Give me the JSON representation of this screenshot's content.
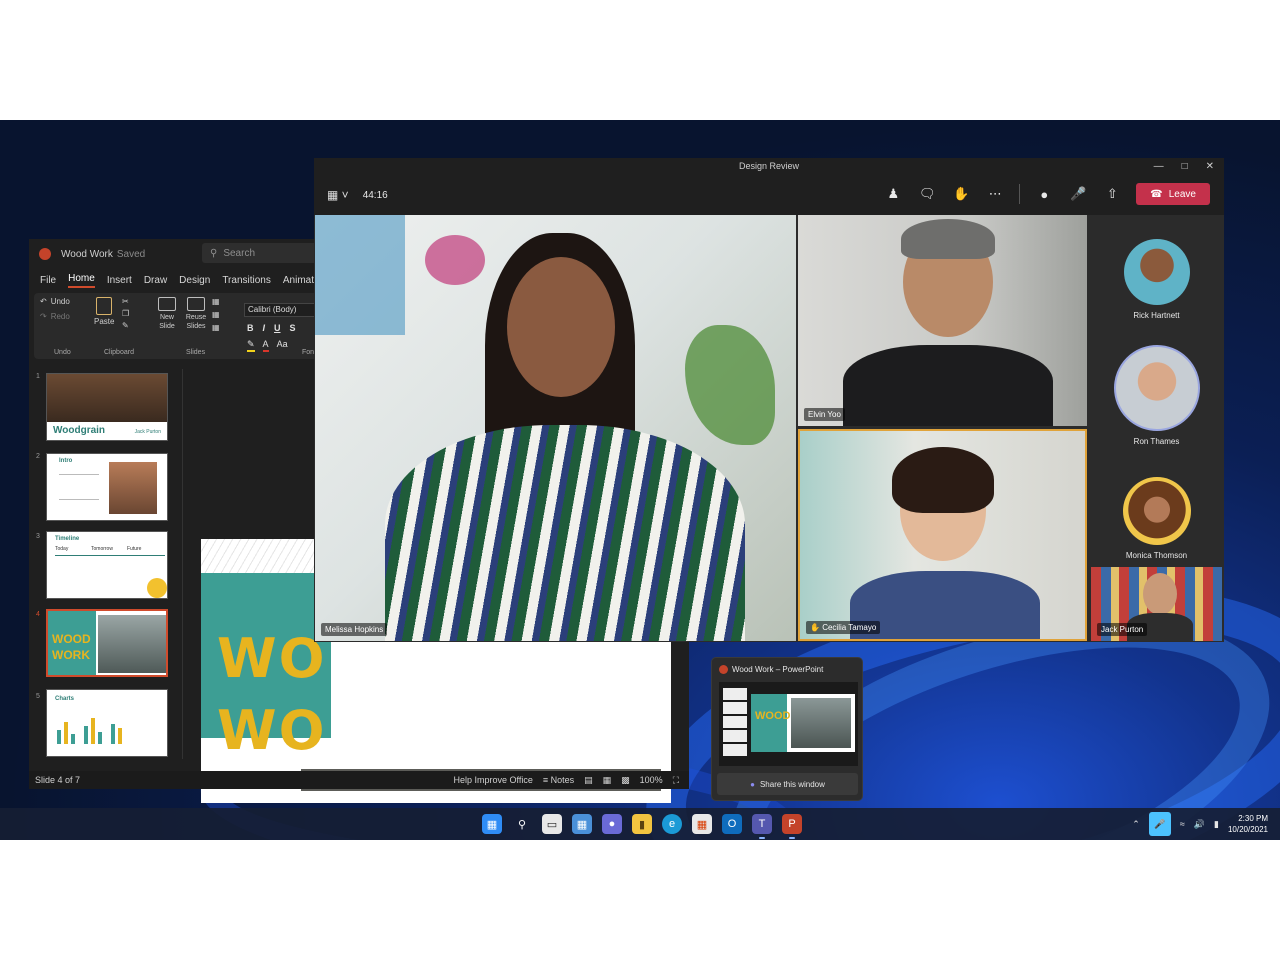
{
  "powerpoint": {
    "doc_name": "Wood Work",
    "saved_status": "Saved",
    "search_placeholder": "Search",
    "tabs": [
      "File",
      "Home",
      "Insert",
      "Draw",
      "Design",
      "Transitions",
      "Animations"
    ],
    "active_tab": "Home",
    "ribbon": {
      "undo": "Undo",
      "redo": "Redo",
      "undo_group": "Undo",
      "paste": "Paste",
      "clipboard_group": "Clipboard",
      "new_slide": "New Slide",
      "reuse_slides": "Reuse Slides",
      "slides_group": "Slides",
      "font_name": "Calibri (Body)",
      "font_group": "Fon"
    },
    "slides": [
      {
        "num": "1",
        "title": "Woodgrain",
        "author": "Jack Purton"
      },
      {
        "num": "2",
        "title": "Intro"
      },
      {
        "num": "3",
        "title": "Timeline",
        "labels": [
          "Today",
          "Tomorrow",
          "Future"
        ]
      },
      {
        "num": "4",
        "title": "WOOD WORK"
      },
      {
        "num": "5",
        "title": "Charts"
      }
    ],
    "canvas_text": [
      "WO",
      "WO"
    ],
    "status": {
      "slide_counter": "Slide 4 of 7",
      "help": "Help Improve Office",
      "notes": "Notes",
      "zoom": "100%"
    }
  },
  "teams": {
    "window_title": "Design Review",
    "call_timer": "44:16",
    "leave_label": "Leave",
    "participants_video": [
      {
        "name": "Melissa Hopkins"
      },
      {
        "name": "Elvin Yoo"
      },
      {
        "name": "Cecilia Tamayo"
      },
      {
        "name": "Jack Purton"
      }
    ],
    "roster": [
      {
        "name": "Rick Hartnett"
      },
      {
        "name": "Ron Thames"
      },
      {
        "name": "Monica Thomson"
      }
    ]
  },
  "share_popover": {
    "title": "Wood Work – PowerPoint",
    "button": "Share this window"
  },
  "taskbar": {
    "time": "2:30 PM",
    "date": "10/20/2021"
  },
  "colors": {
    "ppt_accent": "#d04b2c",
    "teams_leave": "#c4314b",
    "highlight_tile": "#e0a33a",
    "slide_teal": "#3d9e94",
    "slide_yellow": "#e7b41f"
  }
}
